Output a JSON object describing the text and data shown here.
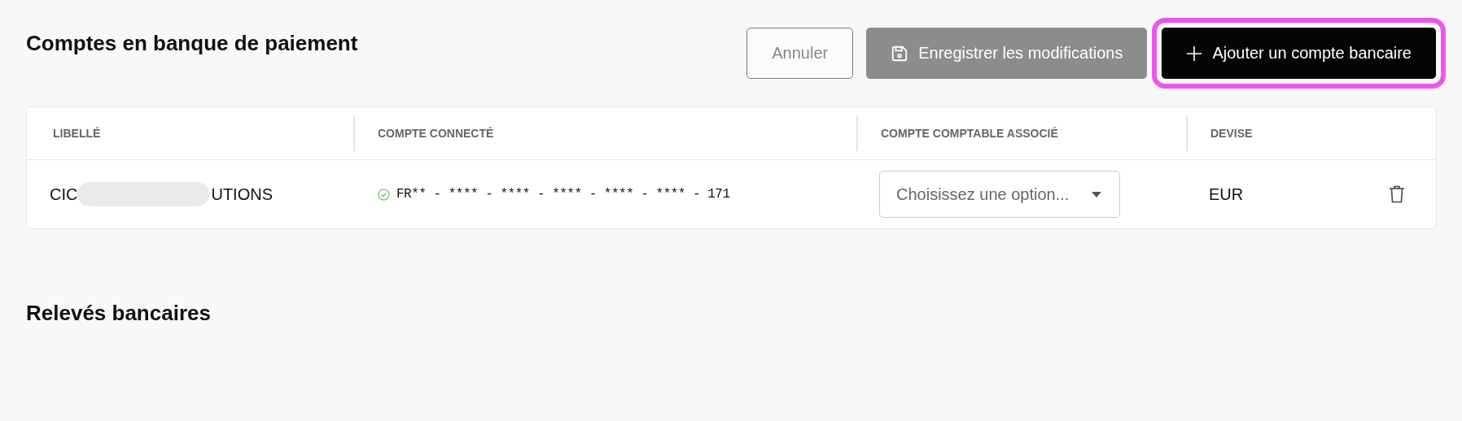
{
  "section_title": "Comptes en banque de paiement",
  "buttons": [
    {
      "kind": "outline",
      "label": "Annuler",
      "highlighted": false
    },
    {
      "kind": "disabled",
      "label": "Enregistrer les modifications",
      "highlighted": false
    },
    {
      "kind": "primary",
      "label": "Ajouter un compte bancaire",
      "highlighted": true
    }
  ],
  "table": {
    "columns": [
      "LIBELLÉ",
      "COMPTE CONNECTÉ",
      "COMPTE COMPTABLE ASSOCIÉ",
      "DEVISE"
    ],
    "rows": [
      {
        "label_start": "CIC",
        "label_redacted": true,
        "label_end": "UTIONS",
        "connected": true,
        "account": "FR** - **** - **** - **** - **** - **** - 171",
        "select": {
          "placeholder": "Choisissez une option..."
        },
        "currency": "EUR"
      }
    ]
  },
  "second_title": "Relevés bancaires"
}
